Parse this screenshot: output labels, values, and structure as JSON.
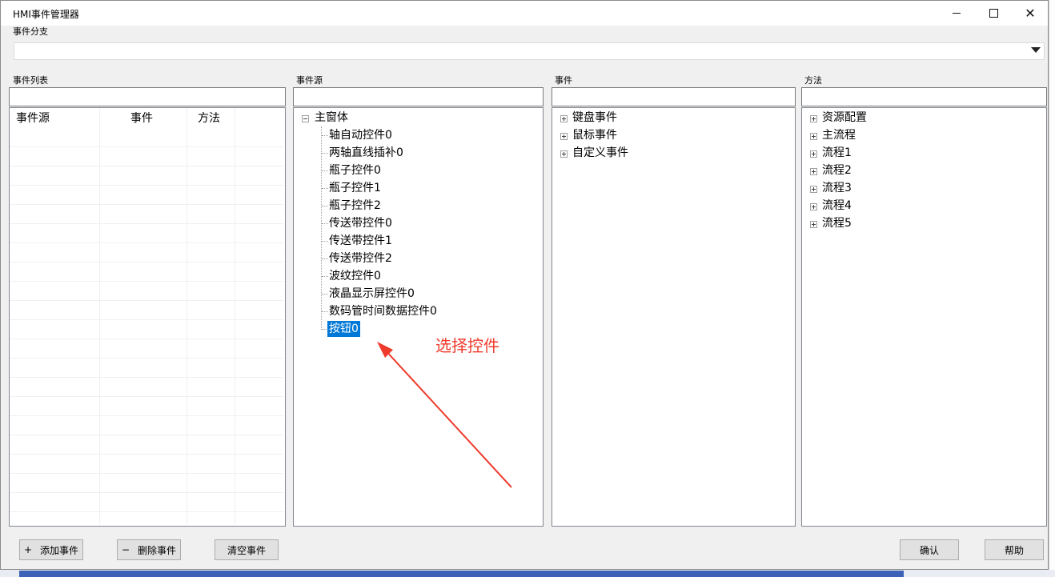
{
  "window": {
    "title": "HMI事件管理器"
  },
  "branch": {
    "label": "事件分支",
    "value": ""
  },
  "event_list": {
    "label": "事件列表",
    "columns": [
      "事件源",
      "事件",
      "方法"
    ],
    "rows": []
  },
  "source_panel": {
    "label": "事件源",
    "root": "主窗体",
    "items": [
      "轴自动控件0",
      "两轴直线插补0",
      "瓶子控件0",
      "瓶子控件1",
      "瓶子控件2",
      "传送带控件0",
      "传送带控件1",
      "传送带控件2",
      "波纹控件0",
      "液晶显示屏控件0",
      "数码管时间数据控件0",
      "按钮0"
    ],
    "selected": "按钮0"
  },
  "event_panel": {
    "label": "事件",
    "items": [
      "键盘事件",
      "鼠标事件",
      "自定义事件"
    ]
  },
  "method_panel": {
    "label": "方法",
    "items": [
      "资源配置",
      "主流程",
      "流程1",
      "流程2",
      "流程3",
      "流程4",
      "流程5"
    ]
  },
  "annotation": {
    "text": "选择控件",
    "color": "#ef3b2c"
  },
  "buttons": {
    "add": "添加事件",
    "add_icon": "+",
    "delete": "删除事件",
    "delete_icon": "−",
    "clear": "清空事件",
    "ok": "确认",
    "help": "帮助"
  },
  "colors": {
    "selection": "#0078d7",
    "annotation": "#ef3b2c"
  }
}
